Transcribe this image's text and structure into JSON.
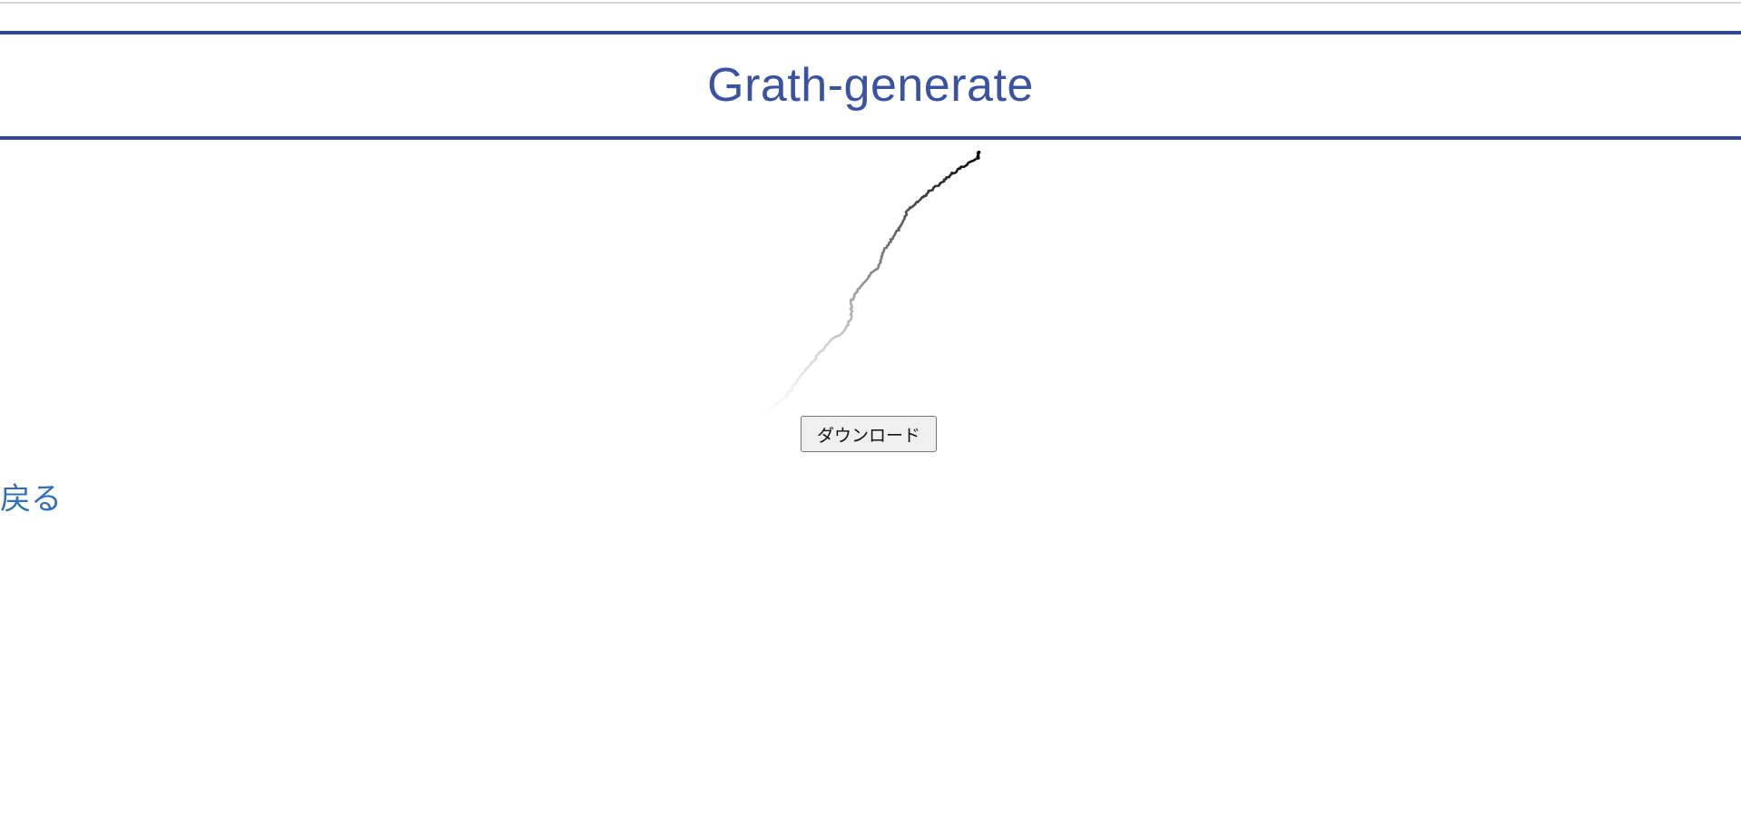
{
  "header": {
    "title": "Grath-generate"
  },
  "actions": {
    "download_label": "ダウンロード",
    "back_label": "戻る"
  },
  "colors": {
    "title": "#3a53a0",
    "rule": "#33498f",
    "link": "#2f6fb8",
    "line_start": "#ffffff",
    "line_end": "#000000"
  },
  "graph": {
    "type": "line",
    "description_free": true
  }
}
